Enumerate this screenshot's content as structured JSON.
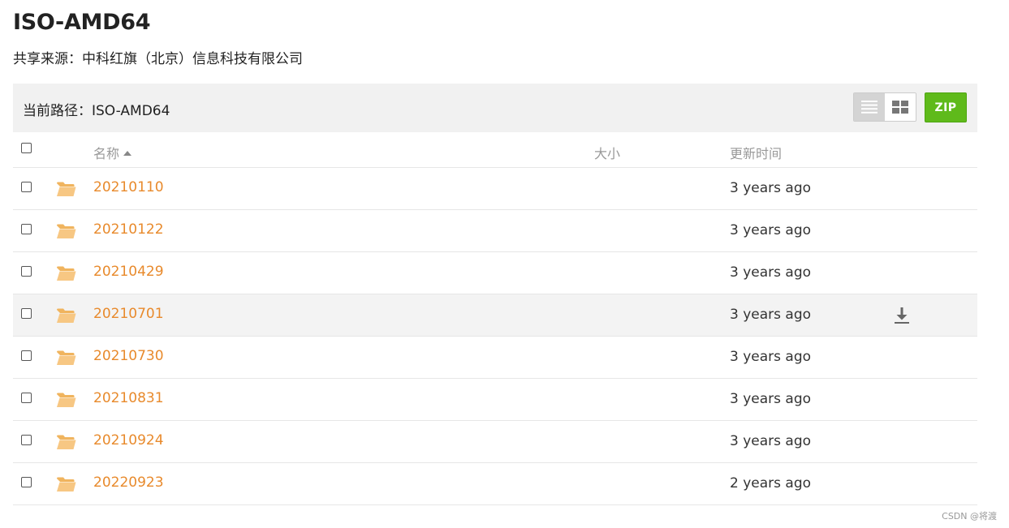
{
  "page": {
    "title": "ISO-AMD64",
    "share_source": "共享来源：中科红旗（北京）信息科技有限公司"
  },
  "toolbar": {
    "path_label": "当前路径：ISO-AMD64",
    "list_view_icon": "list-view-icon",
    "grid_view_icon": "grid-view-icon",
    "zip_label": "ZIP"
  },
  "table": {
    "headers": {
      "name": "名称",
      "size": "大小",
      "modified": "更新时间"
    },
    "rows": [
      {
        "name": "20210110",
        "size": "",
        "modified": "3 years ago"
      },
      {
        "name": "20210122",
        "size": "",
        "modified": "3 years ago"
      },
      {
        "name": "20210429",
        "size": "",
        "modified": "3 years ago"
      },
      {
        "name": "20210701",
        "size": "",
        "modified": "3 years ago",
        "hovered": true
      },
      {
        "name": "20210730",
        "size": "",
        "modified": "3 years ago"
      },
      {
        "name": "20210831",
        "size": "",
        "modified": "3 years ago"
      },
      {
        "name": "20210924",
        "size": "",
        "modified": "3 years ago"
      },
      {
        "name": "20220923",
        "size": "",
        "modified": "2 years ago"
      }
    ]
  },
  "footer": {
    "watermark": "CSDN @将渡"
  },
  "colors": {
    "accent": "#e88a2c",
    "zip": "#5fba1b",
    "folder": "#f5c27a",
    "bar": "#f1f1f1"
  }
}
